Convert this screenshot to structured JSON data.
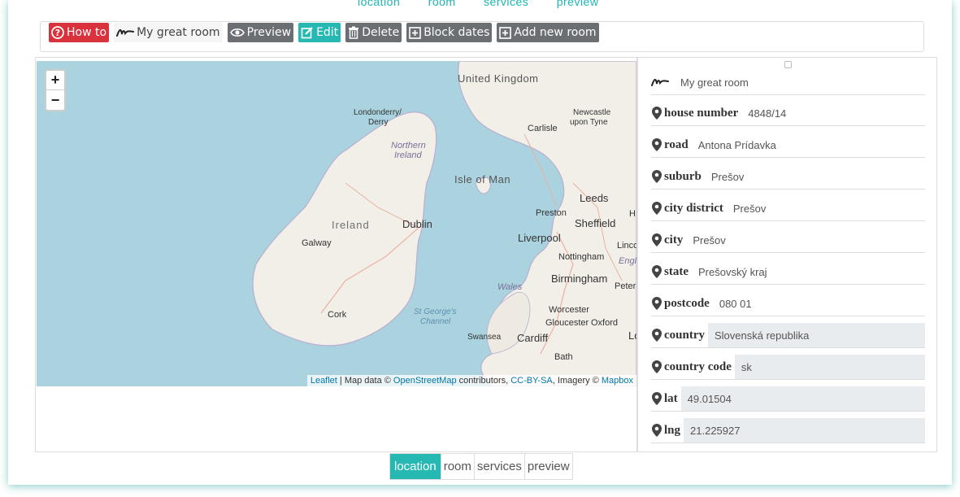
{
  "top_nav": [
    "location",
    "room",
    "services",
    "preview"
  ],
  "toolbar": {
    "howto": "How to",
    "room_name": "My great room",
    "preview": "Preview",
    "edit": "Edit",
    "delete": "Delete",
    "block_dates": "Block dates",
    "add_new_room": "Add new room"
  },
  "map": {
    "zoom_in": "+",
    "zoom_out": "−",
    "attribution": {
      "leaflet": "Leaflet",
      "sep": " | Map data © ",
      "osm": "OpenStreetMap",
      "contrib": " contributors, ",
      "license": "CC-BY-SA",
      "imagery": ", Imagery © ",
      "mapbox": "Mapbox"
    },
    "labels": {
      "united_kingdom": "United Kingdom",
      "londonderry": "Londonderry/",
      "derry": "Derry",
      "northern": "Northern",
      "ireland_ni": "Ireland",
      "newcastle": "Newcastle",
      "upon_tyne": "upon Tyne",
      "carlisle": "Carlisle",
      "isle_of_man": "Isle of Man",
      "leeds": "Leeds",
      "preston": "Preston",
      "sheffield": "Sheffield",
      "ireland": "Ireland",
      "dublin": "Dublin",
      "galway": "Galway",
      "liverpool": "Liverpool",
      "nottingham": "Nottingham",
      "birmingham": "Birmingham",
      "wales": "Wales",
      "cork": "Cork",
      "st_georges": "St George's",
      "channel": "Channel",
      "worcester": "Worcester",
      "gloucester": "Gloucester",
      "oxford": "Oxford",
      "swansea": "Swansea",
      "cardiff": "Cardiff",
      "bath": "Bath",
      "linco": "Linco",
      "engl": "Engl",
      "peterl": "Peterl",
      "lo": "Lo",
      "h": "H"
    }
  },
  "address": {
    "room_name": "My great room",
    "fields": [
      {
        "label": "house number",
        "value": "4848/14"
      },
      {
        "label": "road",
        "value": "Antona Prídavka"
      },
      {
        "label": "suburb",
        "value": "Prešov"
      },
      {
        "label": "city district",
        "value": "Prešov"
      },
      {
        "label": "city",
        "value": "Prešov"
      },
      {
        "label": "state",
        "value": "Prešovský kraj"
      },
      {
        "label": "postcode",
        "value": "080 01"
      },
      {
        "label": "country",
        "value": "Slovenská republika"
      },
      {
        "label": "country code",
        "value": "sk"
      },
      {
        "label": "lat",
        "value": "49.01504"
      },
      {
        "label": "lng",
        "value": "21.225927"
      }
    ]
  },
  "pager": [
    "location",
    "room",
    "services",
    "preview"
  ],
  "colors": {
    "accent": "#26b8b3",
    "danger": "#d9323d",
    "secondary": "#6b6f74",
    "water": "#aad3df",
    "land": "#f2efe9"
  }
}
